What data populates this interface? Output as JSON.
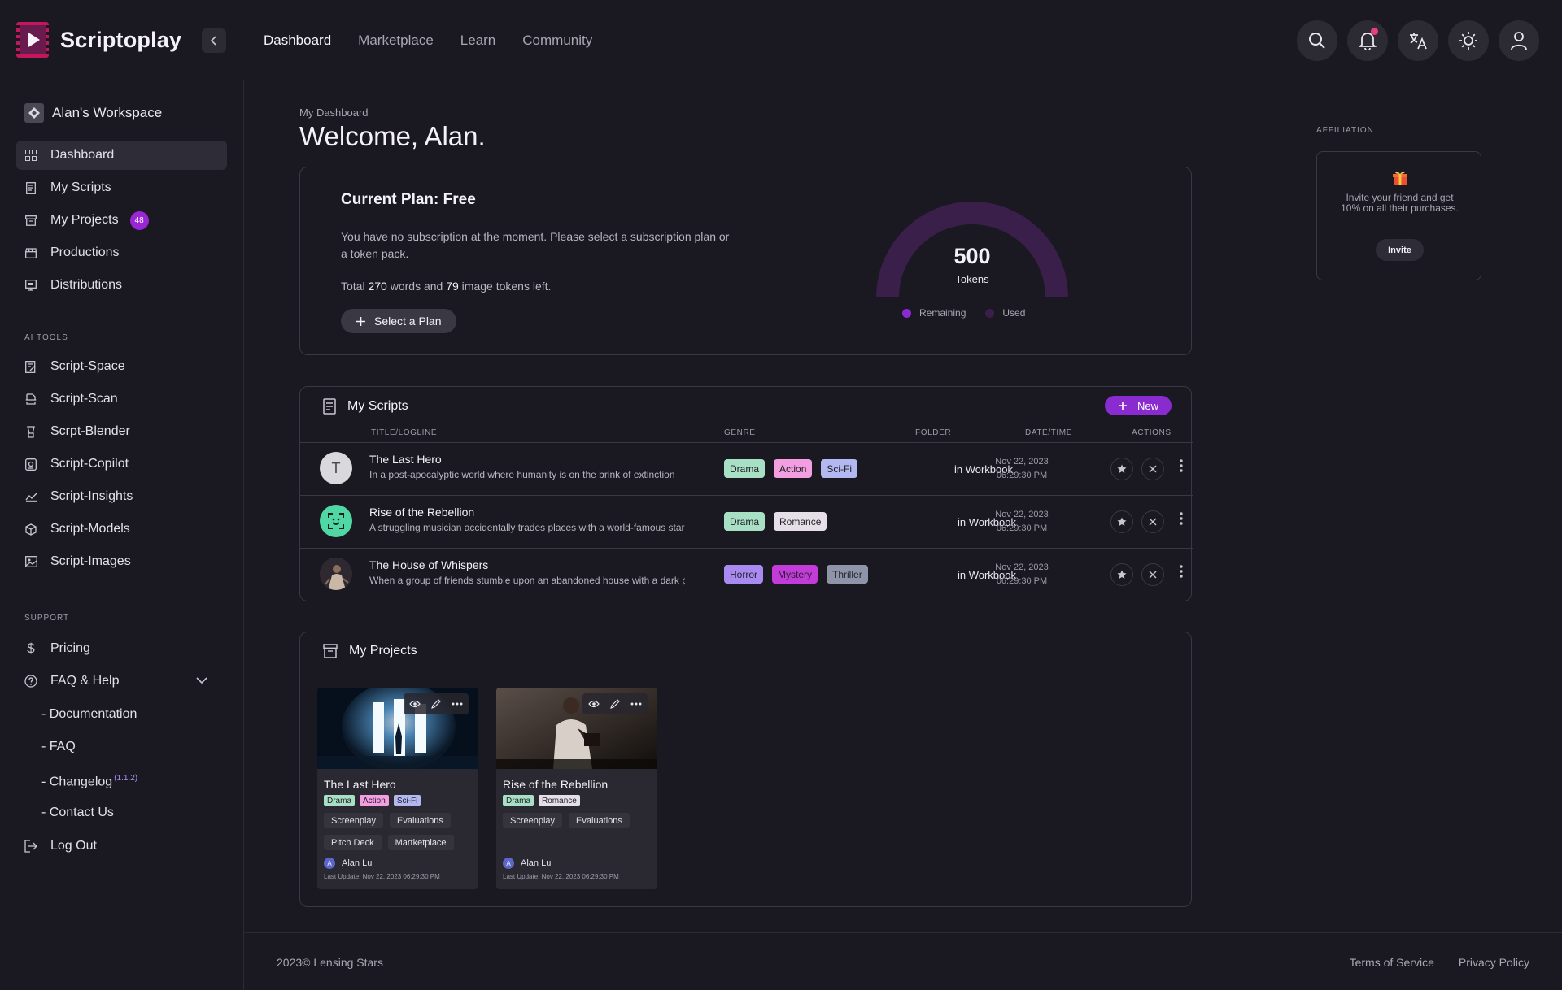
{
  "header": {
    "app_name": "Scriptoplay",
    "nav": [
      "Dashboard",
      "Marketplace",
      "Learn",
      "Community"
    ],
    "active_nav": "Dashboard"
  },
  "sidebar": {
    "workspace": "Alan's Workspace",
    "main_items": [
      {
        "label": "Dashboard",
        "icon": "grid-icon",
        "active": true
      },
      {
        "label": "My Scripts",
        "icon": "script-icon"
      },
      {
        "label": "My Projects",
        "icon": "archive-icon",
        "badge": "48"
      },
      {
        "label": "Productions",
        "icon": "clapper-icon"
      },
      {
        "label": "Distributions",
        "icon": "monitor-icon"
      }
    ],
    "ai_tools_heading": "AI TOOLS",
    "ai_tools": [
      {
        "label": "Script-Space",
        "icon": "document-edit-icon"
      },
      {
        "label": "Script-Scan",
        "icon": "scan-icon"
      },
      {
        "label": "Scrpt-Blender",
        "icon": "blender-icon"
      },
      {
        "label": "Script-Copilot",
        "icon": "copilot-icon"
      },
      {
        "label": "Script-Insights",
        "icon": "chart-line-icon"
      },
      {
        "label": "Script-Models",
        "icon": "cube-icon"
      },
      {
        "label": "Script-Images",
        "icon": "image-icon"
      }
    ],
    "support_heading": "SUPPORT",
    "support": {
      "pricing": "Pricing",
      "faq_help": "FAQ & Help",
      "sub": [
        "Documentation",
        "FAQ",
        "Changelog",
        "Contact Us"
      ],
      "changelog_version": "(1.1.2)",
      "logout": "Log Out"
    }
  },
  "main": {
    "breadcrumb": "My Dashboard",
    "welcome": "Welcome, Alan.",
    "plan": {
      "title": "Current Plan: Free",
      "description": "You have no subscription at the moment. Please select a subscription plan or a token pack.",
      "tokens_prefix": "Total",
      "words": "270",
      "words_mid": "words and",
      "images": "79",
      "images_suffix": "image tokens left.",
      "button": "Select a Plan",
      "gauge_value": "500",
      "gauge_label": "Tokens",
      "legend_remaining": "Remaining",
      "legend_used": "Used",
      "color_remaining": "#8a2bd0",
      "color_used": "#3a1f4a"
    },
    "scripts": {
      "title": "My Scripts",
      "new_button": "New",
      "columns": [
        "TITLE/LOGLINE",
        "GENRE",
        "FOLDER",
        "DATE/TIME",
        "ACTIONS"
      ],
      "rows": [
        {
          "title": "The Last Hero",
          "logline": "In a post-apocalyptic world where humanity is on the brink of extinction",
          "genres": [
            "Drama",
            "Action",
            "Sci-Fi"
          ],
          "folder": "in Workbook",
          "date": "Nov 22, 2023",
          "time": "06:29:30 PM",
          "avatar_letter": "T"
        },
        {
          "title": "Rise of the Rebellion",
          "logline": "A struggling musician accidentally trades places with a world-famous star",
          "genres": [
            "Drama",
            "Romance"
          ],
          "folder": "in Workbook",
          "date": "Nov 22, 2023",
          "time": "06:29:30 PM"
        },
        {
          "title": "The House of Whispers",
          "logline": "When a group of friends stumble upon an abandoned house with a dark past",
          "genres": [
            "Horror",
            "Mystery",
            "Thriller"
          ],
          "folder": "in Workbook",
          "date": "Nov 22, 2023",
          "time": "06:29:30 PM"
        }
      ]
    },
    "projects": {
      "title": "My Projects",
      "cards": [
        {
          "title": "The Last Hero",
          "genres": [
            "Drama",
            "Action",
            "Sci-Fi"
          ],
          "chips": [
            "Screenplay",
            "Evaluations",
            "Pitch Deck",
            "Martketplace"
          ],
          "user": "Alan Lu",
          "user_initial": "A",
          "updated": "Last Update: Nov 22, 2023  06:29:30 PM"
        },
        {
          "title": "Rise of the Rebellion",
          "genres": [
            "Drama",
            "Romance"
          ],
          "chips": [
            "Screenplay",
            "Evaluations"
          ],
          "user": "Alan Lu",
          "user_initial": "A",
          "updated": "Last Update: Nov 22, 2023  06:29:30 PM"
        }
      ]
    }
  },
  "right": {
    "heading": "AFFILIATION",
    "text": "Invite your friend and get 10% on all their purchases.",
    "button": "Invite"
  },
  "footer": {
    "copyright": "2023© Lensing Stars",
    "terms": "Terms of Service",
    "privacy": "Privacy Policy"
  },
  "colors": {
    "drama": "#a7e0c4",
    "action": "#f29ee0",
    "scifi": "#b3b8f0",
    "romance": "#e6dfe8",
    "horror": "#a98af0",
    "mystery": "#c33bd8",
    "thriller": "#8e95a8",
    "accent": "#8a2bd0"
  }
}
